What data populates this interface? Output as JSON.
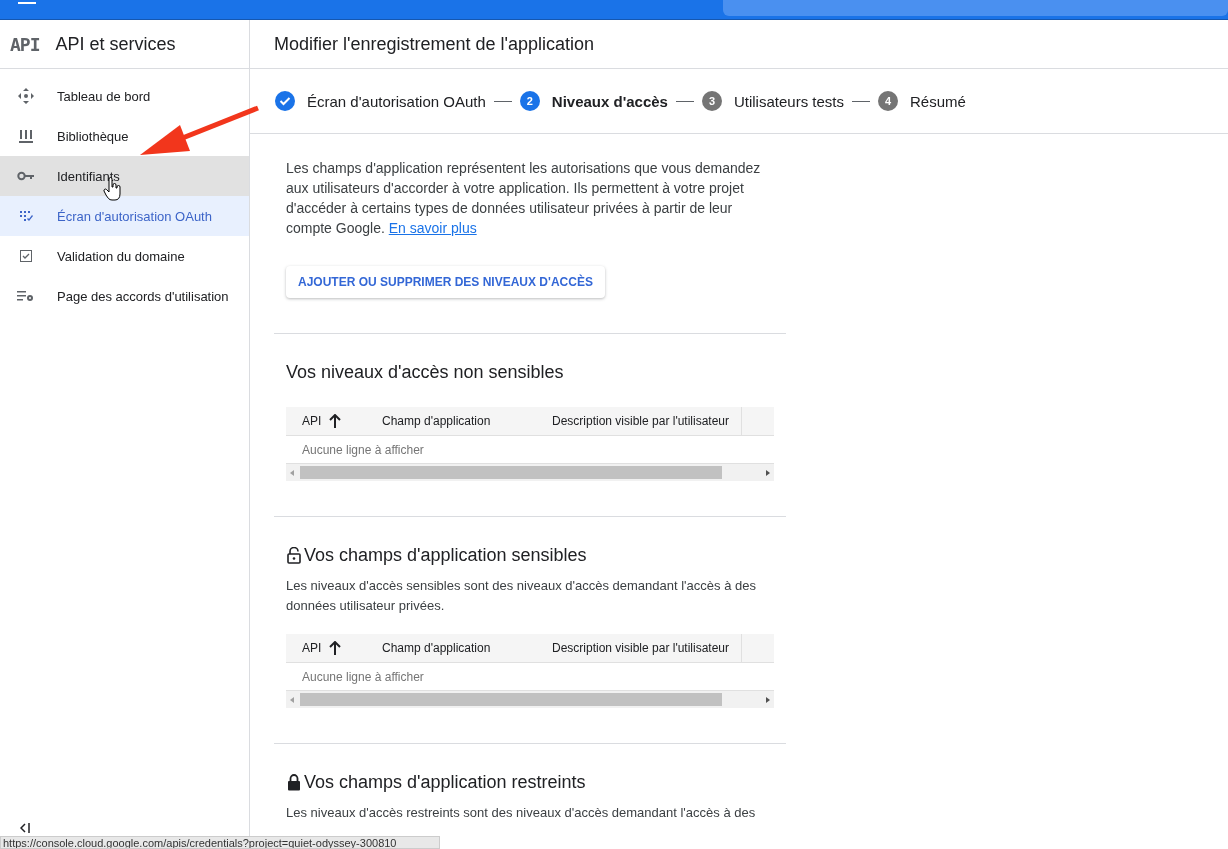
{
  "sidebar": {
    "logo": "API",
    "title": "API et services",
    "items": [
      {
        "label": "Tableau de bord",
        "selected": false,
        "hovered": false
      },
      {
        "label": "Bibliothèque",
        "selected": false,
        "hovered": false
      },
      {
        "label": "Identifiants",
        "selected": false,
        "hovered": true
      },
      {
        "label": "Écran d'autorisation OAuth",
        "selected": true,
        "hovered": false
      },
      {
        "label": "Validation du domaine",
        "selected": false,
        "hovered": false
      },
      {
        "label": "Page des accords d'utilisation",
        "selected": false,
        "hovered": false
      }
    ]
  },
  "page_title": "Modifier l'enregistrement de l'application",
  "steps": [
    {
      "label": "Écran d'autorisation OAuth",
      "done": true,
      "selected": false
    },
    {
      "number": "2",
      "label": "Niveaux d'accès",
      "done": false,
      "selected": true
    },
    {
      "number": "3",
      "label": "Utilisateurs tests",
      "done": false,
      "selected": false
    },
    {
      "number": "4",
      "label": "Résumé",
      "done": false,
      "selected": false
    }
  ],
  "intro": {
    "text": "Les champs d'application représentent les autorisations que vous demandez aux utilisateurs d'accorder à votre application. Ils permettent à votre projet d'accéder à certains types de données utilisateur privées à partir de leur compte Google.",
    "link": "En savoir plus"
  },
  "add_button": "AJOUTER OU SUPPRIMER DES NIVEAUX D'ACCÈS",
  "sections": [
    {
      "title": "Vos niveaux d'accès non sensibles",
      "kind": "plain",
      "columns": [
        "API",
        "Champ d'application",
        "Description visible par l'utilisateur"
      ],
      "empty": "Aucune ligne à afficher"
    },
    {
      "title": "Vos champs d'application sensibles",
      "kind": "unlocked",
      "description": "Les niveaux d'accès sensibles sont des niveaux d'accès demandant l'accès à des données utilisateur privées.",
      "columns": [
        "API",
        "Champ d'application",
        "Description visible par l'utilisateur"
      ],
      "empty": "Aucune ligne à afficher"
    },
    {
      "title": "Vos champs d'application restreints",
      "kind": "locked",
      "description": "Les niveaux d'accès restreints sont des niveaux d'accès demandant l'accès à des"
    }
  ],
  "status_url": "https://console.cloud.google.com/apis/credentials?project=quiet-odyssey-300810"
}
